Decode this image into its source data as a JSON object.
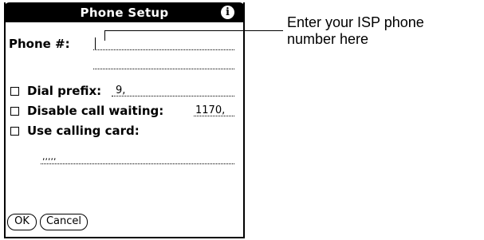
{
  "dialog": {
    "title": "Phone Setup",
    "info_icon": "i",
    "phone_label": "Phone #:",
    "phone_value": "",
    "dial_prefix_label": "Dial prefix:",
    "dial_prefix_value": "9,",
    "disable_call_waiting_label": "Disable call waiting:",
    "disable_call_waiting_value": "1170,",
    "calling_card_label": "Use calling card:",
    "calling_card_value": ",,,,,",
    "ok_label": "OK",
    "cancel_label": "Cancel"
  },
  "callout": {
    "line1": "Enter your ISP phone",
    "line2": "number here"
  }
}
